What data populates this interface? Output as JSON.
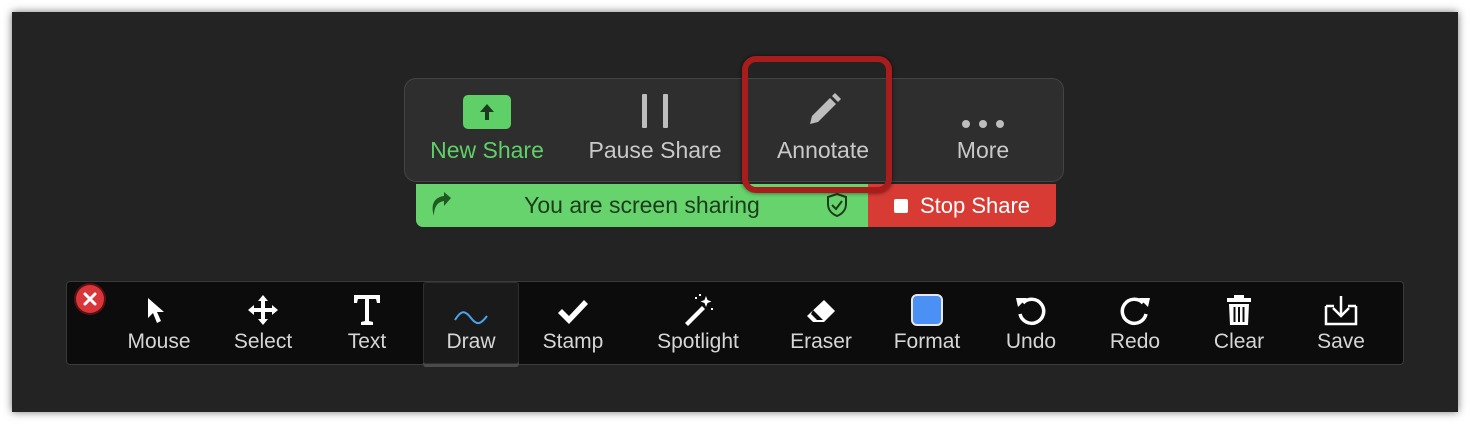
{
  "share_toolbar": {
    "buttons": [
      {
        "label": "New Share",
        "icon": "up-arrow-icon"
      },
      {
        "label": "Pause Share",
        "icon": "pause-icon"
      },
      {
        "label": "Annotate",
        "icon": "pencil-icon"
      },
      {
        "label": "More",
        "icon": "more-dots-icon"
      }
    ]
  },
  "banner": {
    "text": "You are screen sharing",
    "stop_label": "Stop Share"
  },
  "annotation_toolbar": {
    "tools": [
      {
        "label": "Mouse",
        "icon": "cursor-icon"
      },
      {
        "label": "Select",
        "icon": "move-icon"
      },
      {
        "label": "Text",
        "icon": "text-icon"
      },
      {
        "label": "Draw",
        "icon": "squiggle-icon"
      },
      {
        "label": "Stamp",
        "icon": "checkmark-icon"
      },
      {
        "label": "Spotlight",
        "icon": "magic-wand-icon"
      },
      {
        "label": "Eraser",
        "icon": "eraser-icon"
      },
      {
        "label": "Format",
        "icon": "color-swatch-icon"
      },
      {
        "label": "Undo",
        "icon": "undo-icon"
      },
      {
        "label": "Redo",
        "icon": "redo-icon"
      },
      {
        "label": "Clear",
        "icon": "trash-icon"
      },
      {
        "label": "Save",
        "icon": "save-icon"
      }
    ],
    "active_tool": "Draw"
  },
  "colors": {
    "share_green": "#5fd068",
    "stop_red": "#d83b34",
    "format_blue": "#4a90f5",
    "draw_blue": "#4aa3f0",
    "highlight_red": "#a81c1c"
  }
}
